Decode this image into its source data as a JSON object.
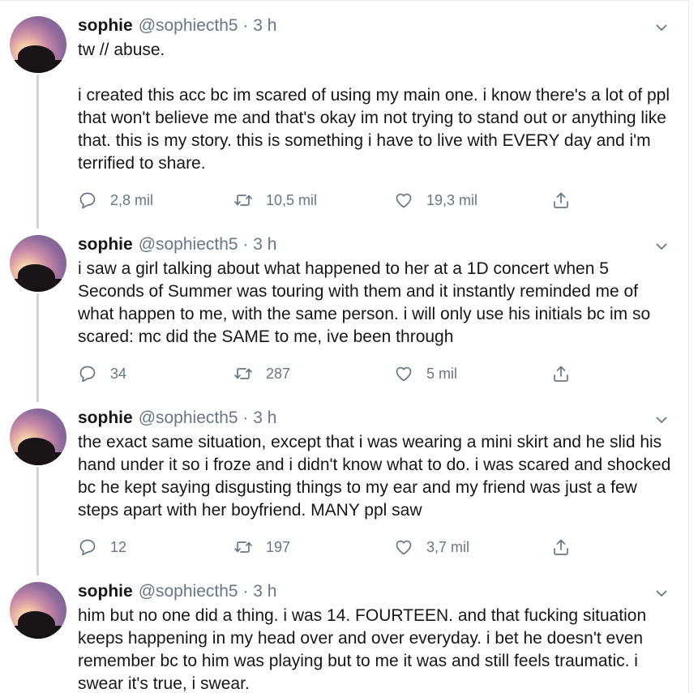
{
  "tweets": [
    {
      "name": "sophie",
      "handle": "@sophiecth5 · 3 h",
      "text": "tw // abuse.\n\ni created this acc bc im scared of using my main one. i know there's a lot of ppl that won't believe me and that's okay im not trying to stand out or anything like that. this is my story. this is something i have to live with EVERY day and i'm terrified to share.",
      "replies": "2,8 mil",
      "retweets": "10,5 mil",
      "likes": "19,3 mil"
    },
    {
      "name": "sophie",
      "handle": "@sophiecth5 · 3 h",
      "text": "i saw a girl talking about what happened to her at a 1D concert when 5 Seconds of Summer was touring with them and it instantly reminded me of what happen to me, with the same person. i will only use his initials bc im so scared: mc did the SAME to me, ive been through",
      "replies": "34",
      "retweets": "287",
      "likes": "5 mil"
    },
    {
      "name": "sophie",
      "handle": "@sophiecth5 · 3 h",
      "text": "the exact same situation, except that i was wearing a mini skirt and he slid his hand under it so i froze and i didn't know what to do. i was scared and shocked bc he kept saying disgusting things to my ear and my friend was just a few steps apart with her boyfriend. MANY ppl saw",
      "replies": "12",
      "retweets": "197",
      "likes": "3,7 mil"
    },
    {
      "name": "sophie",
      "handle": "@sophiecth5 · 3 h",
      "text": "him but no one did a thing. i was 14. FOURTEEN. and that fucking situation keeps happening in my head over and over everyday. i bet he doesn't even remember bc to him was playing but to me it was and still feels traumatic. i swear it's true, i swear."
    }
  ],
  "icons": {
    "reply": "reply-icon",
    "retweet": "retweet-icon",
    "like": "like-icon",
    "share": "share-icon",
    "menu": "chevron-down-icon"
  },
  "colors": {
    "text": "#14171a",
    "secondary": "#657786",
    "thread_line": "#ccd6dd"
  }
}
